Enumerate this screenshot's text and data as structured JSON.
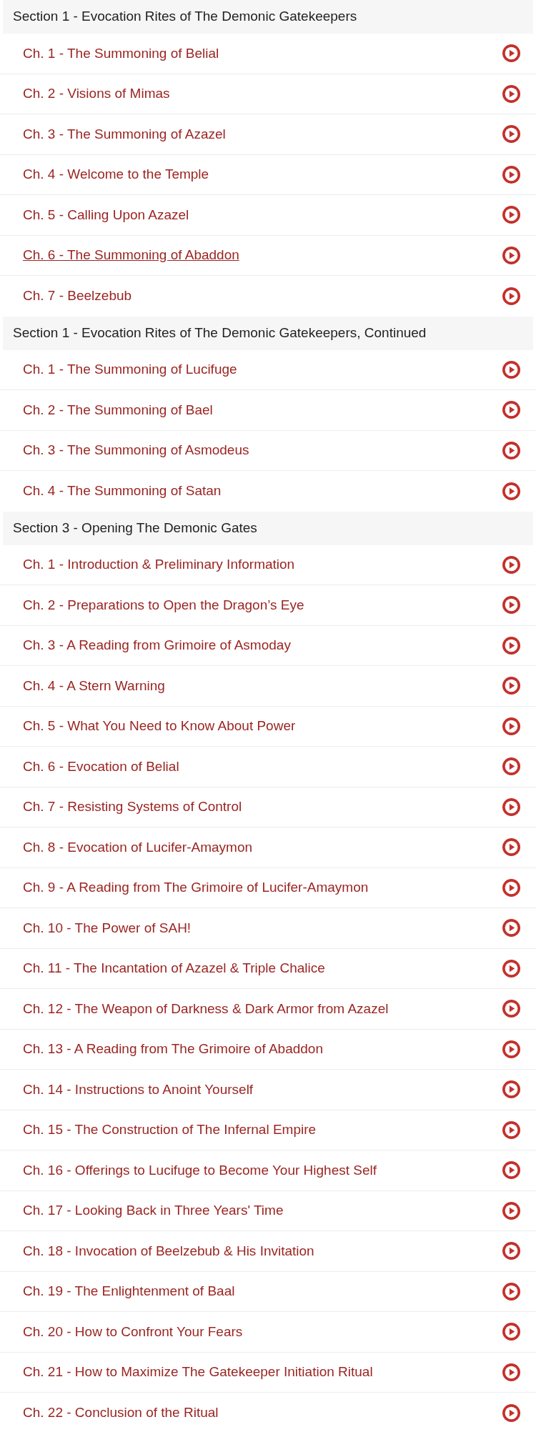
{
  "sections": [
    {
      "title": "Section 1 - Evocation Rites of The Demonic Gatekeepers",
      "lessons": [
        {
          "title": "Ch. 1 - The Summoning of Belial",
          "hovered": false
        },
        {
          "title": "Ch. 2 - Visions of Mimas",
          "hovered": false
        },
        {
          "title": "Ch. 3 - The Summoning of Azazel",
          "hovered": false
        },
        {
          "title": "Ch. 4 - Welcome to the Temple",
          "hovered": false
        },
        {
          "title": "Ch. 5 - Calling Upon Azazel",
          "hovered": false
        },
        {
          "title": "Ch. 6 - The Summoning of Abaddon",
          "hovered": true
        },
        {
          "title": "Ch. 7 - Beelzebub",
          "hovered": false
        }
      ]
    },
    {
      "title": "Section 1 - Evocation Rites of The Demonic Gatekeepers, Continued",
      "lessons": [
        {
          "title": "Ch. 1 - The Summoning of Lucifuge",
          "hovered": false
        },
        {
          "title": "Ch. 2 - The Summoning of Bael",
          "hovered": false
        },
        {
          "title": "Ch. 3 - The Summoning of Asmodeus",
          "hovered": false
        },
        {
          "title": "Ch. 4 - The Summoning of Satan",
          "hovered": false
        }
      ]
    },
    {
      "title": "Section 3 - Opening The Demonic Gates",
      "lessons": [
        {
          "title": "Ch. 1 - Introduction & Preliminary Information",
          "hovered": false
        },
        {
          "title": "Ch. 2 - Preparations to Open the Dragon’s Eye",
          "hovered": false
        },
        {
          "title": "Ch. 3 - A Reading from Grimoire of Asmoday",
          "hovered": false
        },
        {
          "title": "Ch. 4 - A Stern Warning",
          "hovered": false
        },
        {
          "title": "Ch. 5 - What You Need to Know About Power",
          "hovered": false
        },
        {
          "title": "Ch. 6 - Evocation of Belial",
          "hovered": false
        },
        {
          "title": "Ch. 7 - Resisting Systems of Control",
          "hovered": false
        },
        {
          "title": "Ch. 8 - Evocation of Lucifer-Amaymon",
          "hovered": false
        },
        {
          "title": "Ch. 9 - A Reading from The Grimoire of Lucifer-Amaymon",
          "hovered": false
        },
        {
          "title": "Ch. 10 - The Power of SAH!",
          "hovered": false
        },
        {
          "title": "Ch. 11 - The Incantation of Azazel & Triple Chalice",
          "hovered": false
        },
        {
          "title": "Ch. 12 - The Weapon of Darkness & Dark Armor from Azazel",
          "hovered": false
        },
        {
          "title": "Ch. 13 - A Reading from The Grimoire of Abaddon",
          "hovered": false
        },
        {
          "title": "Ch. 14 - Instructions to Anoint Yourself",
          "hovered": false
        },
        {
          "title": "Ch. 15 - The Construction of The Infernal Empire",
          "hovered": false
        },
        {
          "title": "Ch. 16 - Offerings to Lucifuge to Become Your Highest Self",
          "hovered": false
        },
        {
          "title": "Ch. 17 - Looking Back in Three Years' Time",
          "hovered": false
        },
        {
          "title": "Ch. 18 - Invocation of Beelzebub & His Invitation",
          "hovered": false
        },
        {
          "title": "Ch. 19 - The Enlightenment of Baal",
          "hovered": false
        },
        {
          "title": "Ch. 20 - How to Confront Your Fears",
          "hovered": false
        },
        {
          "title": "Ch. 21 - How to Maximize The Gatekeeper Initiation Ritual",
          "hovered": false
        },
        {
          "title": "Ch. 22 - Conclusion of the Ritual",
          "hovered": false
        }
      ]
    }
  ]
}
